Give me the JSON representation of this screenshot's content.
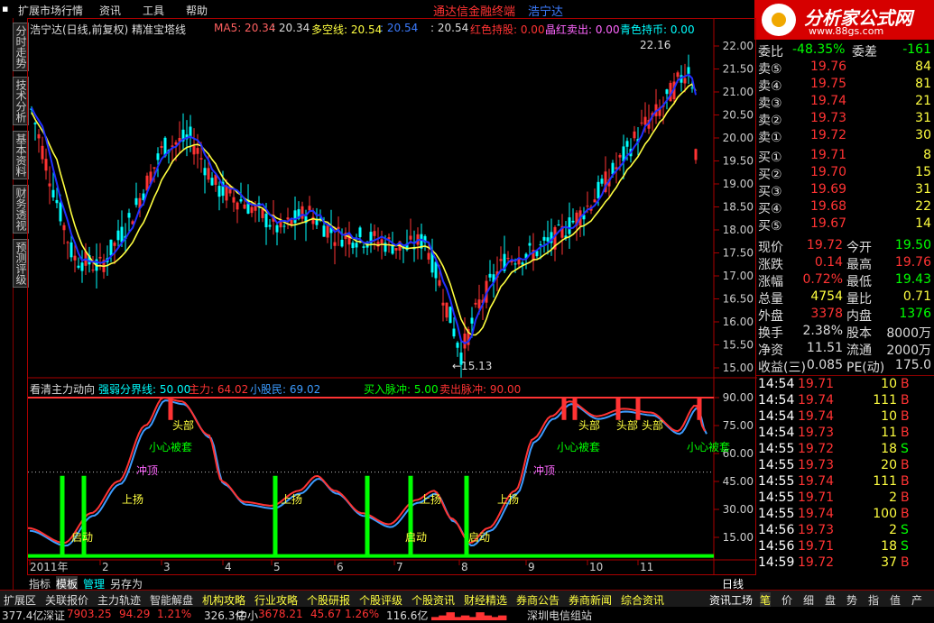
{
  "menu": [
    "扩展市场行情",
    "资讯",
    "工具",
    "帮助"
  ],
  "brand": {
    "name": "通达信金融终端",
    "stock": "浩宁达"
  },
  "logo": {
    "title": "分析家公式网",
    "url": "www.88gs.com"
  },
  "vtabs": [
    "分时走势",
    "技术分析",
    "基本资料",
    "财务透视",
    "预测评级"
  ],
  "main_header": {
    "title": "浩宁达(日线,前复权) 精准宝塔线",
    "ma5": "MA5: 20.34",
    "ma5b": ": 20.34",
    "dk_label": "多空线: 20.54",
    "dk2": ": 20.54",
    "dk3": ": 20.54",
    "red_hold": "红色持股: 0.00",
    "cross_sell": "晶红卖出: 0.00",
    "cyan_hold": "青色持币: 0.00"
  },
  "lower_header": {
    "title": "看清主力动向",
    "strong": "强弱分界线: 50.00",
    "main": "主力: 64.02",
    "retail": "小股民: 69.02",
    "buy": "买入脉冲: 5.00",
    "sell": "卖出脉冲: 90.00"
  },
  "annotations": {
    "high": "22.16",
    "low": "←15.13",
    "head": "头部",
    "trapped": "小心被套",
    "rush": "冲顶",
    "rise": "上扬",
    "start": "启动"
  },
  "price_axis": [
    "22.00",
    "21.50",
    "21.00",
    "20.50",
    "20.00",
    "19.50",
    "19.00",
    "18.50",
    "18.00",
    "17.50",
    "17.00",
    "16.50",
    "16.00",
    "15.50",
    "15.00"
  ],
  "osc_axis": [
    "90.00",
    "75.00",
    "60.00",
    "45.00",
    "30.00",
    "15.00"
  ],
  "x_labels": [
    "2011年",
    "2",
    "3",
    "4",
    "5",
    "6",
    "7",
    "8",
    "9",
    "10",
    "11",
    "日线"
  ],
  "quote": {
    "weibi_label": "委比",
    "weibi": "-48.35%",
    "weicha_label": "委差",
    "weicha": "-161",
    "sells": [
      {
        "label": "卖⑤",
        "price": "19.76",
        "vol": "84"
      },
      {
        "label": "卖④",
        "price": "19.75",
        "vol": "81"
      },
      {
        "label": "卖③",
        "price": "19.74",
        "vol": "21"
      },
      {
        "label": "卖②",
        "price": "19.73",
        "vol": "31"
      },
      {
        "label": "卖①",
        "price": "19.72",
        "vol": "30"
      }
    ],
    "buys": [
      {
        "label": "买①",
        "price": "19.71",
        "vol": "8"
      },
      {
        "label": "买②",
        "price": "19.70",
        "vol": "15"
      },
      {
        "label": "买③",
        "price": "19.69",
        "vol": "31"
      },
      {
        "label": "买④",
        "price": "19.68",
        "vol": "22"
      },
      {
        "label": "买⑤",
        "price": "19.67",
        "vol": "14"
      }
    ],
    "stats": [
      {
        "a": "现价",
        "av": "19.72",
        "b": "今开",
        "bv": "19.50"
      },
      {
        "a": "涨跌",
        "av": "0.14",
        "b": "最高",
        "bv": "19.76"
      },
      {
        "a": "涨幅",
        "av": "0.72%",
        "b": "最低",
        "bv": "19.43"
      },
      {
        "a": "总量",
        "av": "4754",
        "b": "量比",
        "bv": "0.71"
      },
      {
        "a": "外盘",
        "av": "3378",
        "b": "内盘",
        "bv": "1376"
      },
      {
        "a": "换手",
        "av": "2.38%",
        "b": "股本",
        "bv": "8000万"
      },
      {
        "a": "净资",
        "av": "11.51",
        "b": "流通",
        "bv": "2000万"
      },
      {
        "a": "收益(三)",
        "av": "0.085",
        "b": "PE(动)",
        "bv": "175.0"
      }
    ],
    "ticks": [
      {
        "t": "14:54",
        "p": "19.71",
        "v": "10",
        "d": "B"
      },
      {
        "t": "14:54",
        "p": "19.74",
        "v": "111",
        "d": "B"
      },
      {
        "t": "14:54",
        "p": "19.74",
        "v": "10",
        "d": "B"
      },
      {
        "t": "14:54",
        "p": "19.73",
        "v": "11",
        "d": "B"
      },
      {
        "t": "14:55",
        "p": "19.72",
        "v": "18",
        "d": "S"
      },
      {
        "t": "14:55",
        "p": "19.73",
        "v": "20",
        "d": "B"
      },
      {
        "t": "14:55",
        "p": "19.74",
        "v": "111",
        "d": "B"
      },
      {
        "t": "14:55",
        "p": "19.71",
        "v": "2",
        "d": "B"
      },
      {
        "t": "14:55",
        "p": "19.74",
        "v": "100",
        "d": "B"
      },
      {
        "t": "14:56",
        "p": "19.73",
        "v": "2",
        "d": "S"
      },
      {
        "t": "14:56",
        "p": "19.71",
        "v": "18",
        "d": "S"
      },
      {
        "t": "14:59",
        "p": "19.72",
        "v": "37",
        "d": "B"
      }
    ]
  },
  "bottom_tabs": [
    "指标",
    "模板",
    "管理",
    "另存为"
  ],
  "bottom_nav": [
    "扩展区",
    "关联报价",
    "主力轨迹",
    "智能解盘",
    "机构攻略",
    "行业攻略",
    "个股研报",
    "个股评级",
    "个股资讯",
    "财经精选",
    "券商公告",
    "券商新闻",
    "综合资讯",
    "资讯工场"
  ],
  "right_tabs": [
    "笔",
    "价",
    "细",
    "盘",
    "势",
    "指",
    "值",
    "产"
  ],
  "status": {
    "a": "377.4亿",
    "sz_label": "深证",
    "sz": "7903.25",
    "sz_chg": "94.29",
    "sz_pct": "1.21%",
    "b": "326.3亿",
    "zx_label": "中小",
    "zx": "3678.21",
    "zx_chg": "45.67",
    "zx_pct": "1.26%",
    "c": "116.6亿",
    "server": "深圳电信组站"
  },
  "colors": {
    "up": "#ff3333",
    "down": "#00ffff",
    "ma": "#ffff40",
    "dk": "#2030ff",
    "green": "#00ff00"
  }
}
